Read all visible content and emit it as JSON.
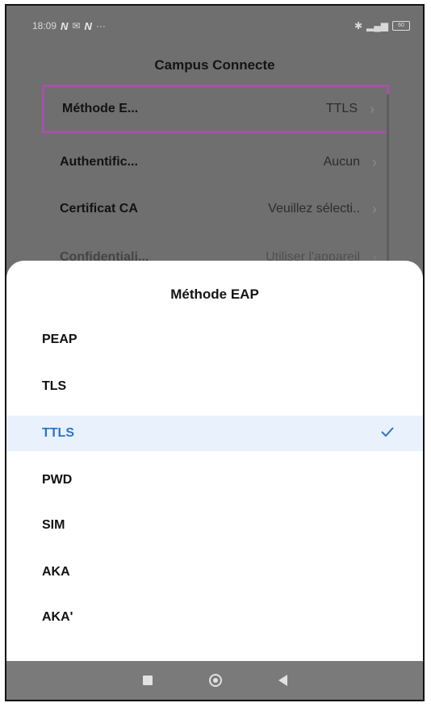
{
  "status_bar": {
    "time": "18:09",
    "left_icons": [
      "N",
      "N"
    ],
    "dots": "···",
    "right_icons": [
      "bluetooth-icon",
      "signal-icon"
    ],
    "battery": "60"
  },
  "screen": {
    "title": "Campus Connecte",
    "rows": [
      {
        "label": "Méthode E...",
        "value": "TTLS"
      },
      {
        "label": "Authentific...",
        "value": "Aucun"
      },
      {
        "label": "Certificat CA",
        "value": "Veuillez sélecti.."
      },
      {
        "label": "Confidentiali...",
        "value": "Utiliser l'appareil"
      }
    ]
  },
  "sheet": {
    "title": "Méthode EAP",
    "options": [
      "PEAP",
      "TLS",
      "TTLS",
      "PWD",
      "SIM",
      "AKA",
      "AKA'"
    ],
    "selected": "TTLS",
    "check_icon": "check-icon"
  },
  "colors": {
    "highlight_border": "#a552a8",
    "selected_text": "#2e73c7",
    "selected_bg": "#e8f1fc",
    "dim_overlay": "#6f6f6f"
  },
  "nav_bar": {
    "icons": [
      "recents-square-icon",
      "home-circle-icon",
      "back-triangle-icon"
    ]
  }
}
